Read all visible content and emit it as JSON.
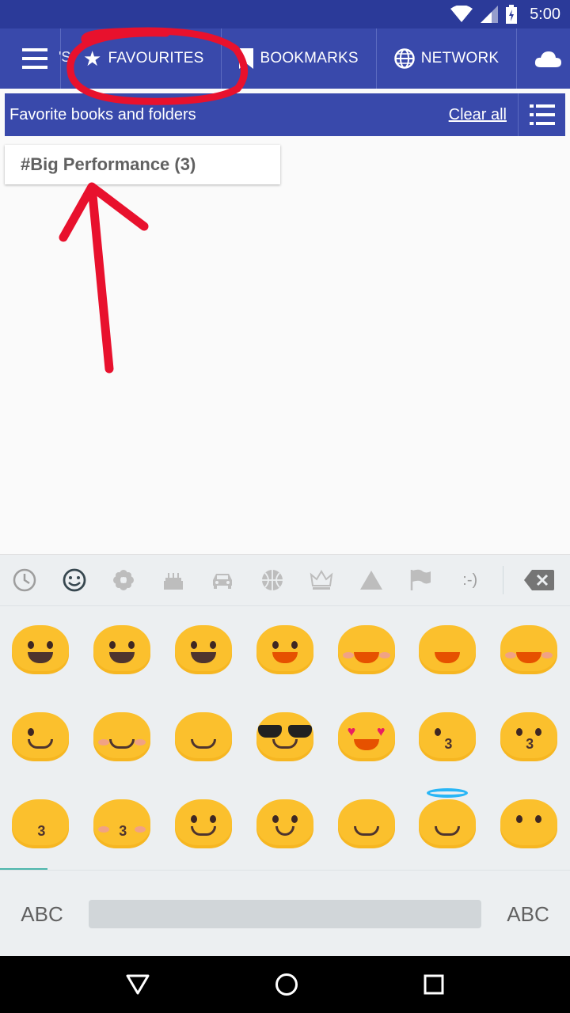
{
  "status_bar": {
    "time": "5:00"
  },
  "tabs": {
    "partial_label": "'S",
    "favourites": "FAVOURITES",
    "bookmarks": "BOOKMARKS",
    "network": "NETWORK"
  },
  "header": {
    "title": "Favorite books and folders",
    "clear_all": "Clear all"
  },
  "folders": [
    {
      "label": "#Big Performance (3)"
    }
  ],
  "keyboard": {
    "categories": [
      "recent-icon",
      "smileys-icon",
      "flower-icon",
      "cake-icon",
      "car-icon",
      "ball-icon",
      "crown-icon",
      "triangle-icon",
      "flag-icon",
      "emoticon-text"
    ],
    "emoticon_text": ":-)",
    "left_label": "ABC",
    "right_label": "ABC"
  },
  "colors": {
    "primary": "#3949ab",
    "status": "#2b3a99",
    "annotation": "#e8112d",
    "emoji": "#fbc02d"
  }
}
